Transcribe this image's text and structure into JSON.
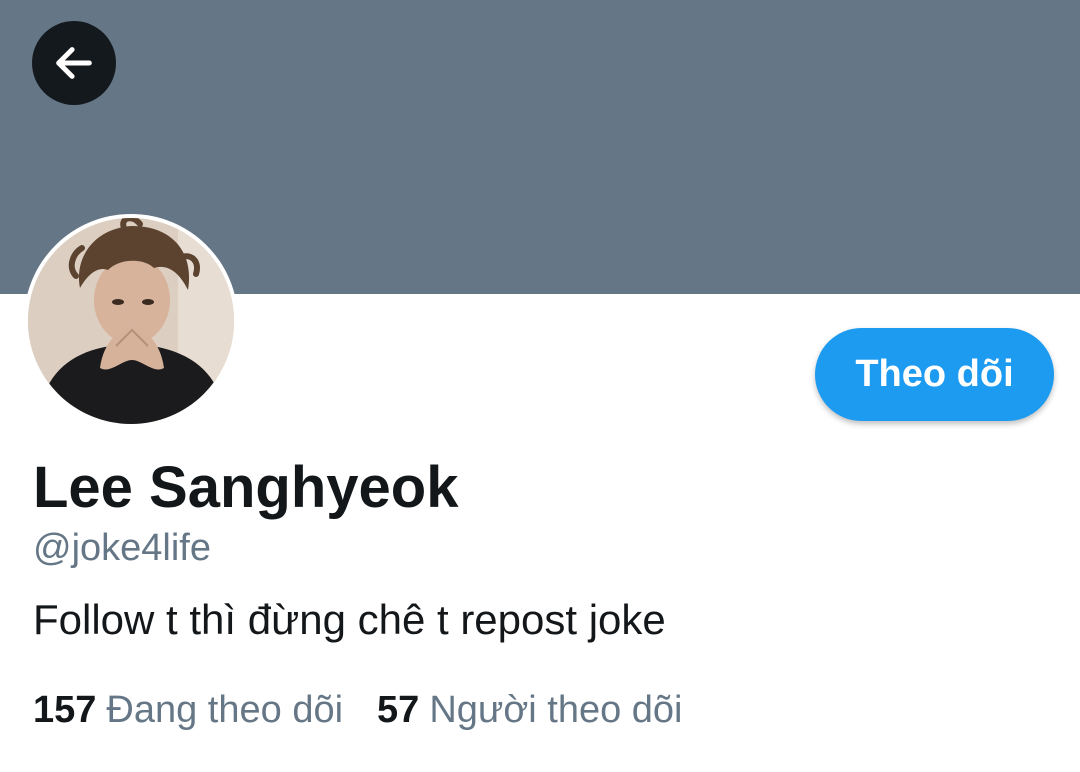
{
  "header": {
    "banner_color": "#657686",
    "back_icon": "arrow-left-icon"
  },
  "profile": {
    "avatar_icon": "profile-photo",
    "follow_label": "Theo dõi",
    "name": "Lee Sanghyeok",
    "handle": "@joke4life",
    "bio": "Follow t thì đừng chê t repost joke"
  },
  "stats": {
    "following_count": "157",
    "following_label": "Đang theo dõi",
    "followers_count": "57",
    "followers_label": "Người theo dõi"
  },
  "colors": {
    "accent": "#1d9bf0",
    "text_primary": "#14171a",
    "text_secondary": "#657786"
  }
}
